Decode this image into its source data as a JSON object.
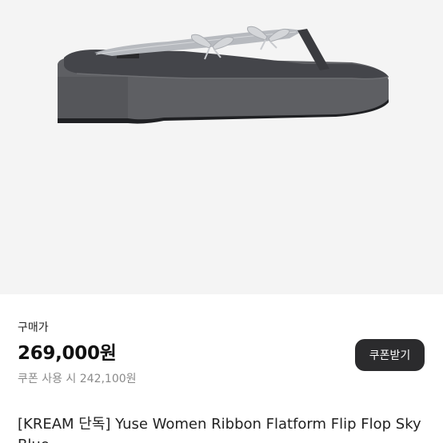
{
  "product": {
    "image_alt": "flip-flop platform sandal product photo",
    "title": "[KREAM 단독] Yuse Women Ribbon Flatform Flip Flop Sky Blue"
  },
  "purchase": {
    "price_label": "구매가",
    "price": "269,000원",
    "coupon_price": "쿠폰 사용 시 242,100원",
    "coupon_button_label": "쿠폰받기"
  },
  "colors": {
    "sole": "#5c5d61",
    "strap": "#b9bcc1",
    "button_bg": "#2b2b2d",
    "image_bg": "#f4f4f4"
  }
}
